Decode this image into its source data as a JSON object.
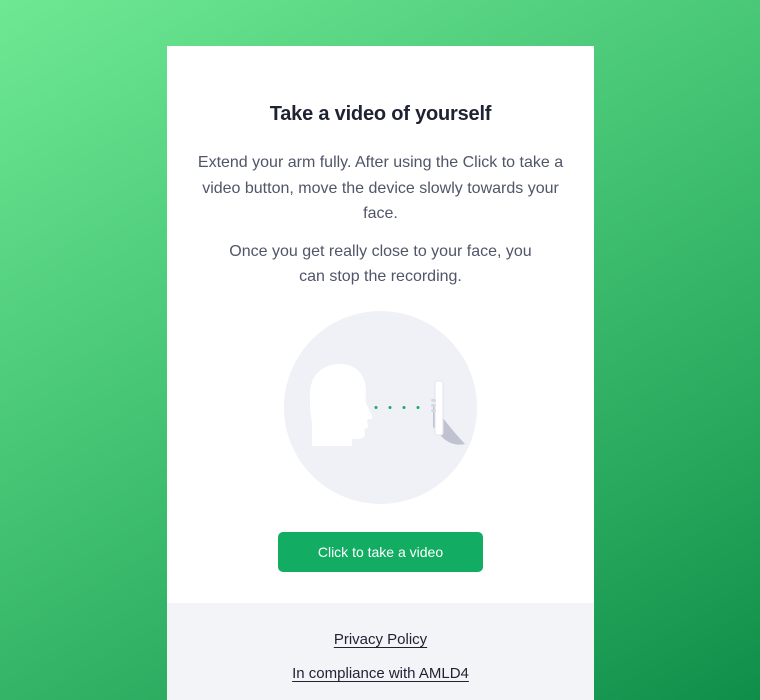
{
  "card": {
    "title": "Take a video of yourself",
    "instructions": [
      "Extend your arm fully. After using the Click to take a video button, move the device slowly towards your face.",
      "Once you get really close to your face, you can stop the recording."
    ],
    "illustration_icon": "face-with-phone-illustration",
    "cta_label": "Click to take a video"
  },
  "footer": {
    "privacy_label": "Privacy Policy",
    "compliance_label": "In compliance with AMLD4"
  },
  "colors": {
    "background_gradient_start": "#6fe893",
    "background_gradient_end": "#0f8e4a",
    "accent": "#12ad63",
    "title_text": "#1f2233",
    "body_text": "#505568",
    "footer_bg": "#f3f4f8",
    "illustration_circle": "#f0f1f6"
  }
}
